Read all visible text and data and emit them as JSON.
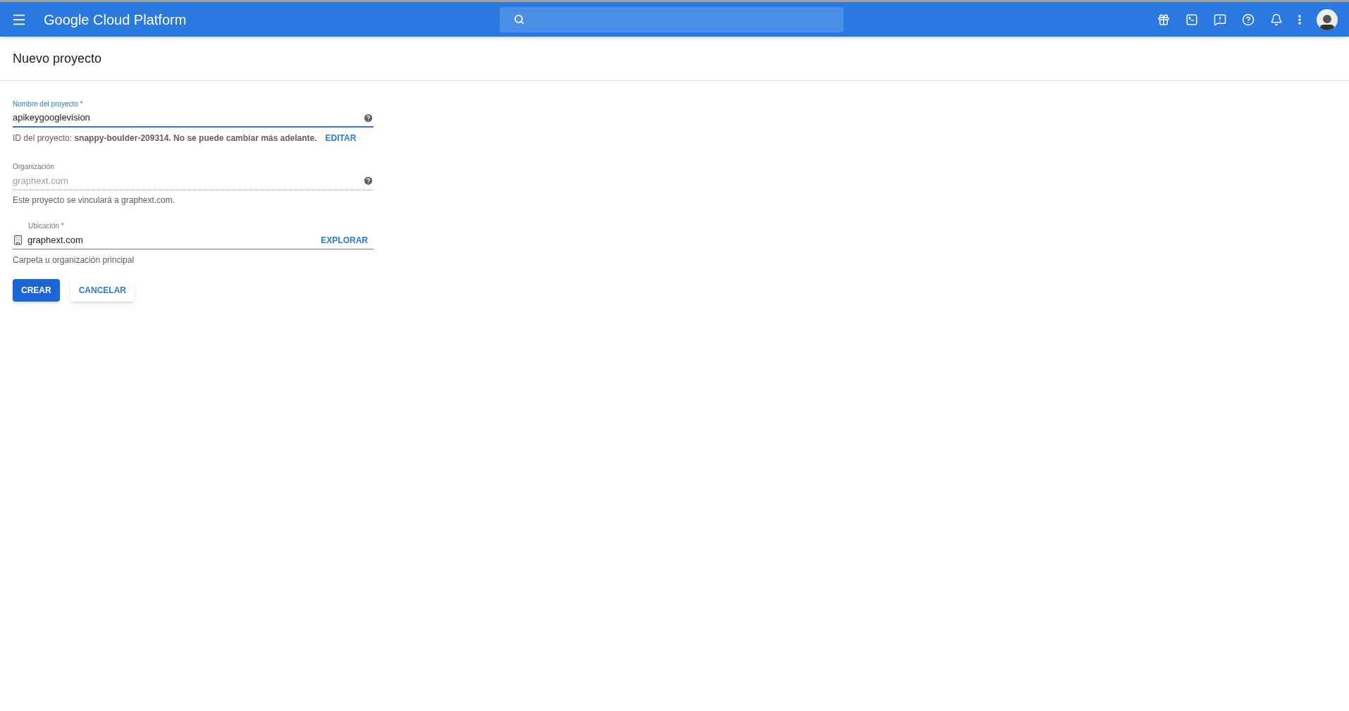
{
  "header": {
    "title": "Google Cloud Platform"
  },
  "page": {
    "title": "Nuevo proyecto"
  },
  "project_name": {
    "label": "Nombre del proyecto *",
    "value": "apikeygooglevision",
    "focused": true
  },
  "project_id": {
    "text": "ID del proyecto: **snappy-boulder-209314. No se puede cambiar más adelante.**",
    "link": "EDITAR"
  },
  "organization": {
    "label": "Organización",
    "value": "graphext.com",
    "disabled": true,
    "hint": "Este proyecto se vinculará a graphext.com."
  },
  "location": {
    "label": "Ubicación *",
    "value": "graphext.com",
    "link": "EXPLORAR",
    "hint": "Carpeta u organización principal"
  },
  "buttons": [
    {
      "label": "CREAR",
      "kind": "primary"
    },
    {
      "label": "CANCELAR",
      "kind": "secondary"
    }
  ]
}
